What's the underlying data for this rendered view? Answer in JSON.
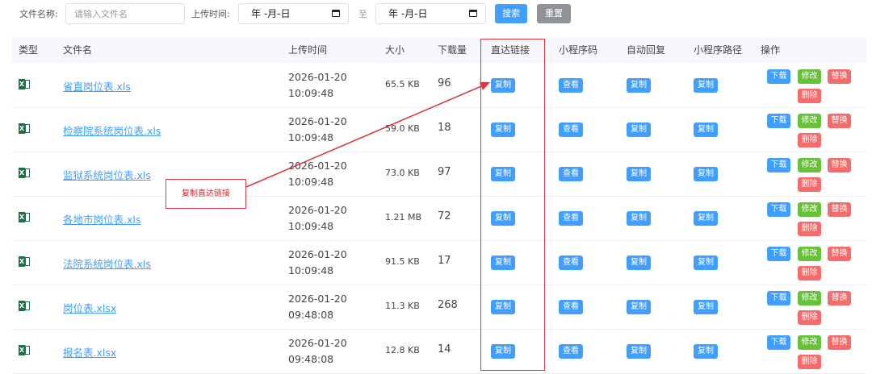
{
  "filter": {
    "name_label": "文件名称:",
    "name_placeholder": "请输入文件名",
    "time_label": "上传时间:",
    "date_start": "年 -月-日",
    "to": "至",
    "date_end": "年 -月-日",
    "search": "搜索",
    "reset": "重置"
  },
  "headers": [
    "类型",
    "文件名",
    "上传时间",
    "大小",
    "下载量",
    "直达链接",
    "小程序码",
    "自动回复",
    "小程序路径",
    "操作"
  ],
  "rows": [
    {
      "name": "省直岗位表.xls",
      "date": "2026-01-20",
      "time": "10:09:48",
      "size": "65.5 KB",
      "downloads": "96"
    },
    {
      "name": "检察院系统岗位表.xls",
      "date": "2026-01-20",
      "time": "10:09:48",
      "size": "59.0 KB",
      "downloads": "18"
    },
    {
      "name": "监狱系统岗位表.xls",
      "date": "2026-01-20",
      "time": "10:09:48",
      "size": "73.0 KB",
      "downloads": "97"
    },
    {
      "name": "各地市岗位表.xls",
      "date": "2026-01-20",
      "time": "10:09:48",
      "size": "1.21 MB",
      "downloads": "72"
    },
    {
      "name": "法院系统岗位表.xls",
      "date": "2026-01-20",
      "time": "10:09:48",
      "size": "91.5 KB",
      "downloads": "17"
    },
    {
      "name": "岗位表.xlsx",
      "date": "2026-01-20",
      "time": "09:48:08",
      "size": "11.3 KB",
      "downloads": "268"
    },
    {
      "name": "报名表.xlsx",
      "date": "2026-01-20",
      "time": "09:48:08",
      "size": "12.8 KB",
      "downloads": "14"
    }
  ],
  "buttons": {
    "copy": "复制",
    "view": "查看",
    "download": "下载",
    "edit": "修改",
    "replace": "替换",
    "delete": "删除"
  },
  "annotation": "复制直达链接",
  "file_icon": "excel-file-icon",
  "colors": {
    "primary": "#409eff",
    "success": "#67c23a",
    "danger": "#f56c6c",
    "info": "#909399",
    "annotation": "#d9363e"
  }
}
